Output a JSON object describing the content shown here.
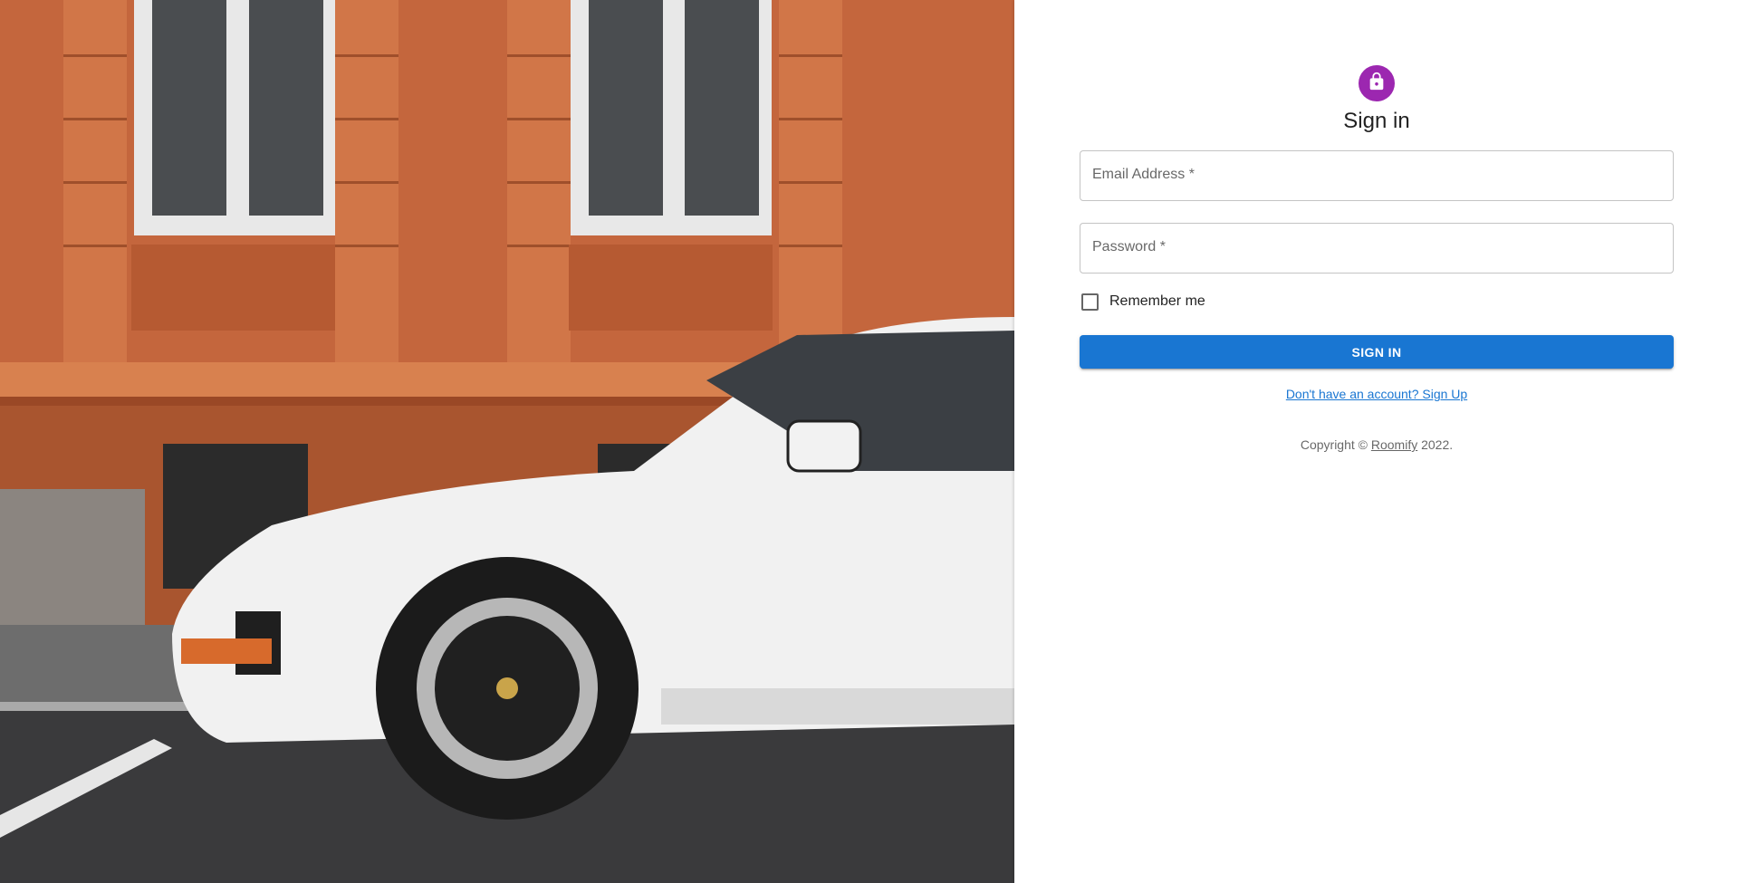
{
  "hero": {
    "image_label": "white-sports-car-in-front-of-orange-building"
  },
  "signin": {
    "icon": "lock-icon",
    "title": "Sign in",
    "email": {
      "label": "Email Address *",
      "value": ""
    },
    "password": {
      "label": "Password *",
      "value": ""
    },
    "remember_label": "Remember me",
    "remember_checked": false,
    "submit_label": "Sign In",
    "signup_link": "Don't have an account? Sign Up",
    "copyright_prefix": "Copyright ©",
    "copyright_brand": "Roomify",
    "copyright_suffix": "2022."
  },
  "colors": {
    "avatar": "#9c27b0",
    "primary": "#1976d2",
    "building": "#c8673e"
  }
}
